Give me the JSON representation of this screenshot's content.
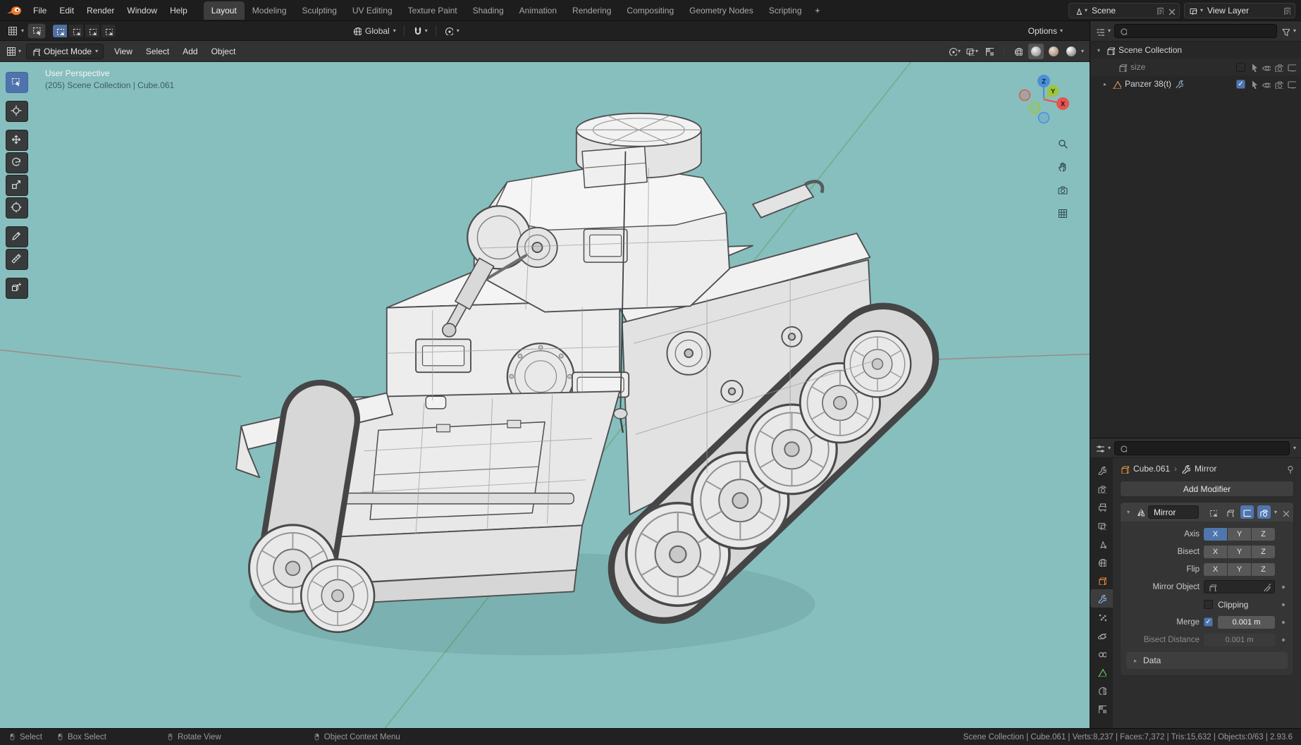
{
  "colors": {
    "accent": "#4f76ad",
    "viewport_bg": "#87bfbf",
    "axis_x": "#e4564f",
    "axis_y": "#9ec43d",
    "axis_z": "#4a8fd9",
    "object_orange": "#e8923f"
  },
  "topbar": {
    "menus": [
      {
        "label": "File"
      },
      {
        "label": "Edit"
      },
      {
        "label": "Render"
      },
      {
        "label": "Window"
      },
      {
        "label": "Help"
      }
    ],
    "tabs": [
      {
        "label": "Layout",
        "active": true
      },
      {
        "label": "Modeling"
      },
      {
        "label": "Sculpting"
      },
      {
        "label": "UV Editing"
      },
      {
        "label": "Texture Paint"
      },
      {
        "label": "Shading"
      },
      {
        "label": "Animation"
      },
      {
        "label": "Rendering"
      },
      {
        "label": "Compositing"
      },
      {
        "label": "Geometry Nodes"
      },
      {
        "label": "Scripting"
      }
    ],
    "add_tab_label": "+",
    "scene_name": "Scene",
    "view_layer_name": "View Layer"
  },
  "tool_settings": {
    "options_label": "Options"
  },
  "viewport": {
    "mode": "Object Mode",
    "menus": [
      {
        "label": "View"
      },
      {
        "label": "Select"
      },
      {
        "label": "Add"
      },
      {
        "label": "Object"
      }
    ],
    "orientation": "Global",
    "overlay_line1": "User Perspective",
    "overlay_line2": "(205) Scene Collection | Cube.061",
    "gizmo": {
      "x": "X",
      "y": "Y",
      "z": "Z"
    }
  },
  "outliner": {
    "search_placeholder": "",
    "rows": [
      {
        "label": "Scene Collection"
      },
      {
        "label": "size"
      },
      {
        "label": "Panzer 38(t)"
      }
    ]
  },
  "properties": {
    "search_placeholder": "",
    "breadcrumb": {
      "object": "Cube.061",
      "modifier": "Mirror"
    },
    "add_modifier_label": "Add Modifier",
    "mirror": {
      "name": "Mirror",
      "rows": {
        "axis_label": "Axis",
        "bisect_label": "Bisect",
        "flip_label": "Flip",
        "axis_options": [
          {
            "label": "X"
          },
          {
            "label": "Y"
          },
          {
            "label": "Z"
          }
        ],
        "mirror_object_label": "Mirror Object",
        "clipping_label": "Clipping",
        "merge_label": "Merge",
        "merge_value": "0.001 m",
        "bisect_distance_label": "Bisect Distance",
        "bisect_distance_value": "0.001 m"
      },
      "data_panel_label": "Data"
    }
  },
  "statusbar": {
    "hints": [
      {
        "label": "Select"
      },
      {
        "label": "Box Select"
      },
      {
        "label": "Rotate View"
      },
      {
        "label": "Object Context Menu"
      }
    ],
    "stats": "Scene Collection | Cube.061 | Verts:8,237 | Faces:7,372 | Tris:15,632 | Objects:0/63 | 2.93.6"
  }
}
